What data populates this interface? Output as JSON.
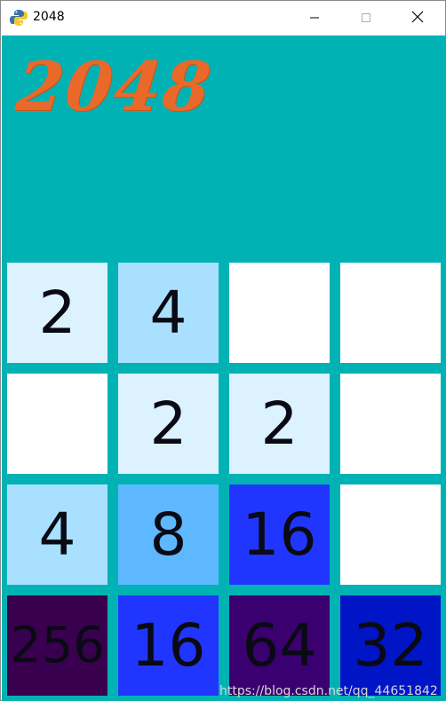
{
  "window": {
    "title": "2048",
    "app_icon": "python-icon",
    "controls": [
      "minimize-icon",
      "maximize-icon",
      "close-icon"
    ]
  },
  "game": {
    "logo_text": "2048",
    "background_color": "#00b2b4",
    "logo_color": "#e8692a",
    "board": [
      [
        "2",
        "4",
        "",
        ""
      ],
      [
        "",
        "2",
        "2",
        ""
      ],
      [
        "4",
        "8",
        "16",
        ""
      ],
      [
        "256",
        "16",
        "64",
        "32"
      ]
    ],
    "tile_colors": {
      "": "#ffffff",
      "2": "#dcf2ff",
      "4": "#aae0ff",
      "8": "#5db8ff",
      "16": "#2036ff",
      "32": "#0015c6",
      "64": "#3a0070",
      "256": "#3a0050"
    }
  },
  "watermark": "https://blog.csdn.net/qq_44651842"
}
